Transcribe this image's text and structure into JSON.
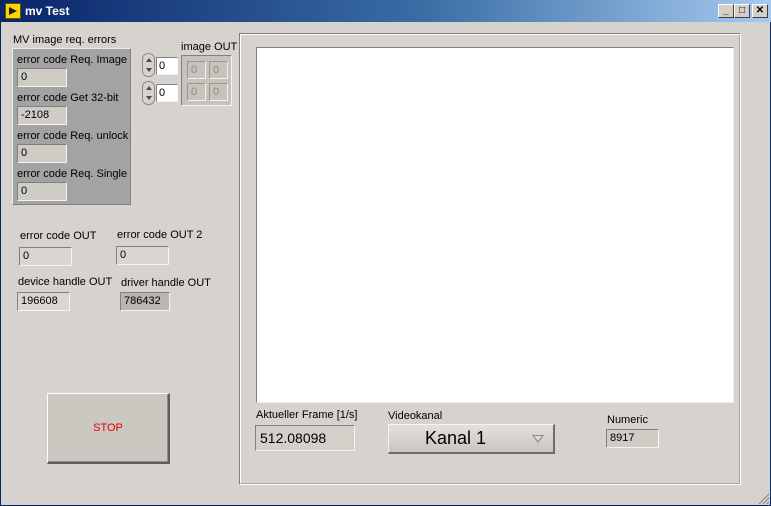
{
  "window": {
    "title": "mv Test",
    "controls": {
      "minimize": "_",
      "maximize": "□",
      "close": "✕"
    }
  },
  "errors_panel": {
    "title": "MV image req. errors",
    "items": [
      {
        "label": "error code Req. Image",
        "value": "0"
      },
      {
        "label": "error code Get 32-bit",
        "value": "-2108"
      },
      {
        "label": "error code Req. unlock",
        "value": "0"
      },
      {
        "label": "error code Req. Single",
        "value": "0"
      }
    ]
  },
  "image_out": {
    "label": "image OUT",
    "index_1": "0",
    "index_2": "0",
    "cells": [
      "0",
      "0",
      "0",
      "0"
    ]
  },
  "outputs": {
    "error_code_out": {
      "label": "error code OUT",
      "value": "0"
    },
    "error_code_out_2": {
      "label": "error code OUT 2",
      "value": "0"
    },
    "device_handle_out": {
      "label": "device handle OUT",
      "value": "196608"
    },
    "driver_handle_out": {
      "label": "driver handle OUT",
      "value": "786432"
    }
  },
  "stop_button": {
    "label": "STOP"
  },
  "frame_rate": {
    "label": "Aktueller Frame [1/s]",
    "value": "512.08098"
  },
  "video_channel": {
    "label": "Videokanal",
    "selected": "Kanal 1"
  },
  "numeric": {
    "label": "Numeric",
    "value": "8917"
  },
  "colors": {
    "title_gradient_start": "#0a246a",
    "title_gradient_end": "#a6caf0",
    "window_bg": "#d6d3ce",
    "stop_text": "#e00000"
  }
}
